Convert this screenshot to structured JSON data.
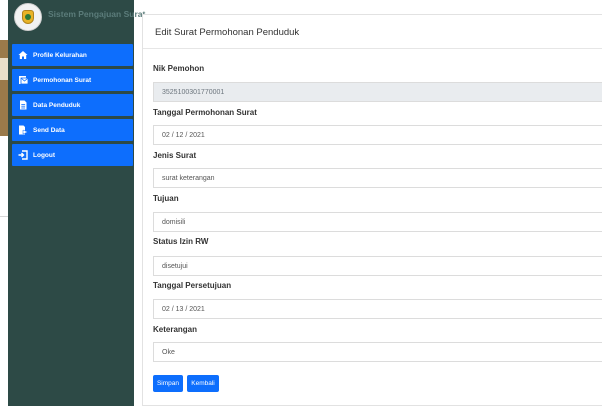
{
  "sidebar": {
    "brand_title": "Sistem Pengajuan Surat",
    "items": [
      {
        "label": "Profile Kelurahan",
        "icon": "home-icon"
      },
      {
        "label": "Permohonan Surat",
        "icon": "mail-icon"
      },
      {
        "label": "Data Penduduk",
        "icon": "document-icon"
      },
      {
        "label": "Send Data",
        "icon": "send-icon"
      },
      {
        "label": "Logout",
        "icon": "logout-icon"
      }
    ],
    "colors": {
      "background": "#2d4a46",
      "item": "#0d6efd",
      "brand_text": "#5b7c7a"
    }
  },
  "main": {
    "title": "Edit Surat Permohonan Penduduk",
    "fields": [
      {
        "label": "Nik Pemohon",
        "value": "3525100301770001",
        "readonly": true
      },
      {
        "label": "Tanggal Permohonan Surat",
        "value": "02 / 12 / 2021",
        "readonly": false
      },
      {
        "label": "Jenis Surat",
        "value": "surat keterangan",
        "readonly": false
      },
      {
        "label": "Tujuan",
        "value": "domisili",
        "readonly": false
      },
      {
        "label": "Status Izin RW",
        "value": "disetujui",
        "readonly": false
      },
      {
        "label": "Tanggal Persetujuan",
        "value": "02 / 13 / 2021",
        "readonly": false
      },
      {
        "label": "Keterangan",
        "value": "Oke",
        "readonly": false
      }
    ],
    "buttons": {
      "save_label": "Simpan",
      "back_label": "Kembali"
    },
    "colors": {
      "button": "#0d6efd",
      "readonly_field": "#e9ecef"
    }
  }
}
